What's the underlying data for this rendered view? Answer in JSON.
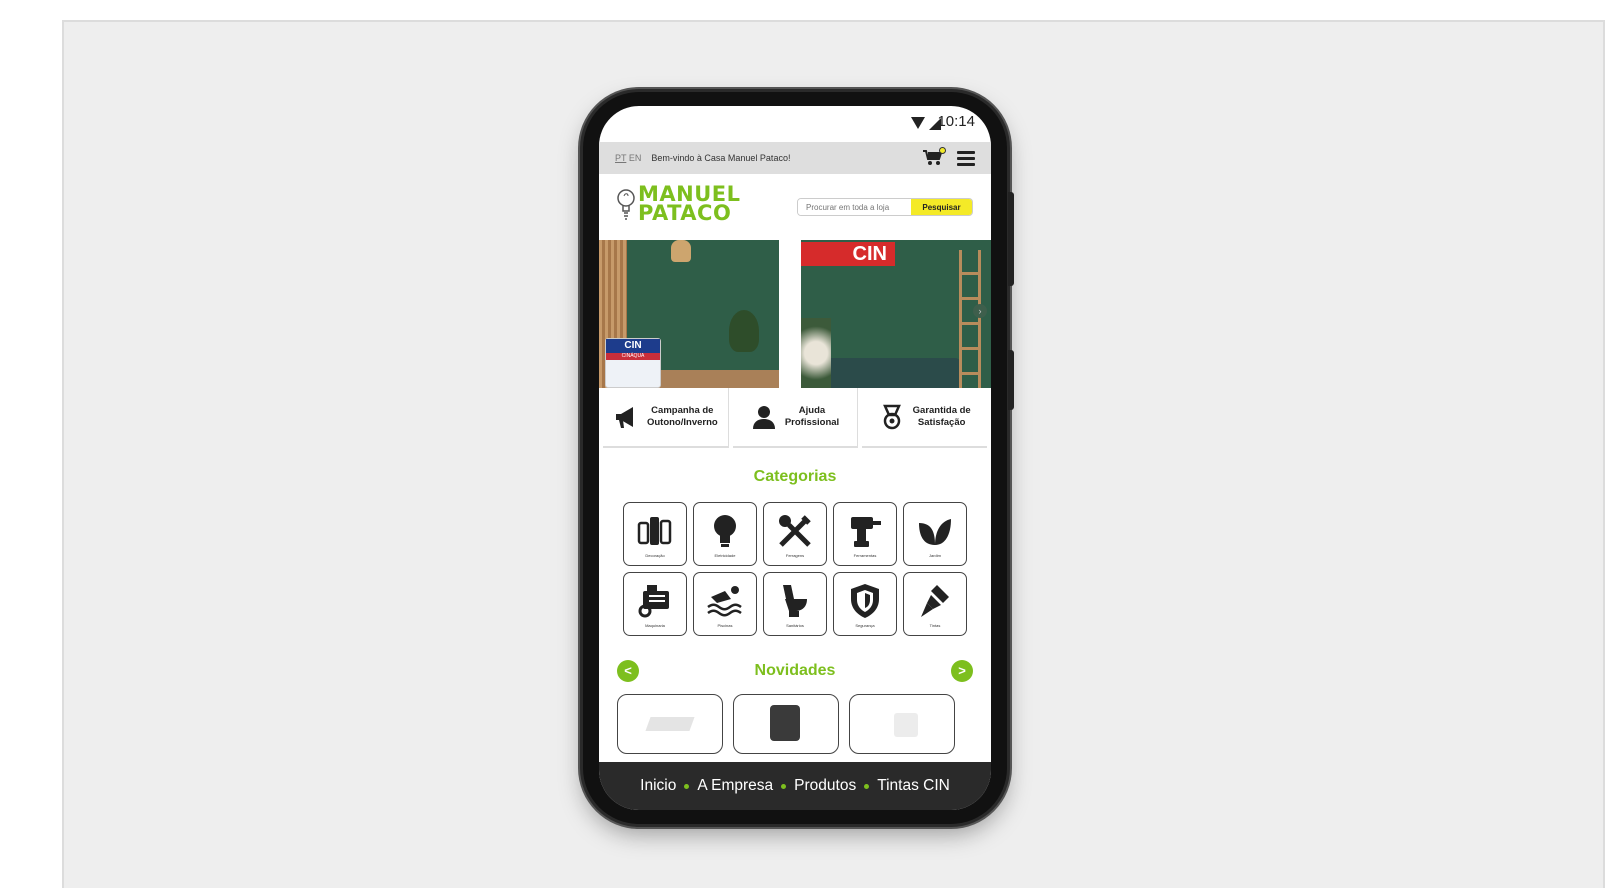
{
  "status_bar": {
    "time": "10:14"
  },
  "topbar": {
    "lang_pt": "PT",
    "lang_en": "EN",
    "welcome": "Bem-vindo à Casa Manuel Pataco!"
  },
  "header": {
    "logo_line1": "MANUEL",
    "logo_line2": "PATACO",
    "search_placeholder": "Procurar em toda a loja",
    "search_button": "Pesquisar"
  },
  "hero": {
    "slide1_can_brand": "CIN",
    "slide1_can_product": "CINÁQUA",
    "slide2_banner": "CIN"
  },
  "features": [
    {
      "label1": "Campanha de",
      "label2": "Outono/Inverno",
      "icon": "megaphone-icon"
    },
    {
      "label1": "Ajuda",
      "label2": "Profissional",
      "icon": "support-agent-icon"
    },
    {
      "label1": "Garantida de",
      "label2": "Satisfação",
      "icon": "medal-icon"
    }
  ],
  "categories_title": "Categorias",
  "categories": [
    {
      "label": "Decoração",
      "icon": "decor-icon"
    },
    {
      "label": "Eletricidade",
      "icon": "bulb-icon"
    },
    {
      "label": "Ferragens",
      "icon": "tools-icon"
    },
    {
      "label": "Ferramentas",
      "icon": "drill-icon"
    },
    {
      "label": "Jardim",
      "icon": "leaves-icon"
    },
    {
      "label": "Maquinaria",
      "icon": "generator-icon"
    },
    {
      "label": "Piscinas",
      "icon": "swimmer-icon"
    },
    {
      "label": "Sanitários",
      "icon": "toilet-icon"
    },
    {
      "label": "Segurança",
      "icon": "shield-icon"
    },
    {
      "label": "Tintas",
      "icon": "paintbrush-icon"
    }
  ],
  "news_title": "Novidades",
  "news_prev": "<",
  "news_next": ">",
  "bottom_nav": [
    "Inicio",
    "A Empresa",
    "Produtos",
    "Tintas CIN"
  ],
  "colors": {
    "accent": "#7dbf1e",
    "search_button": "#f4ea27",
    "nav_bg": "#2a2a2a",
    "banner_red": "#d62b2b"
  }
}
